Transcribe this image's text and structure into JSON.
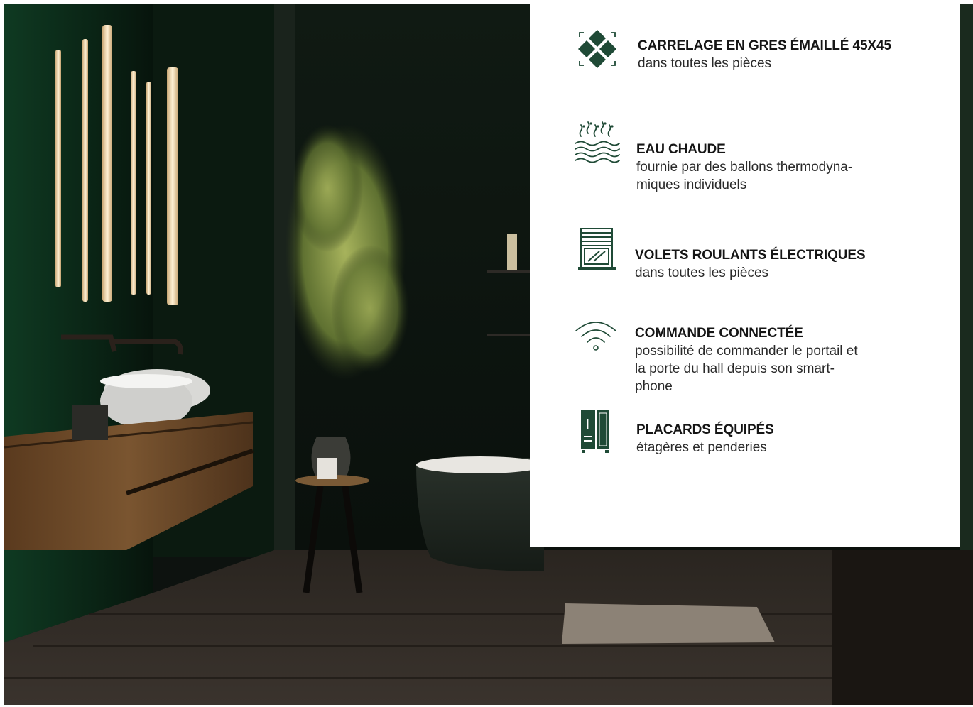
{
  "colors": {
    "accent": "#1f4a36",
    "panel_background": "#ffffff",
    "text": "#151515"
  },
  "photo": {
    "subject": "dark green bathroom interior"
  },
  "features": [
    {
      "icon": "tile-icon",
      "title": "CARRELAGE EN GRES ÉMAILLÉ 45X45",
      "desc": "dans toutes les pièces"
    },
    {
      "icon": "hot-water-icon",
      "title": "EAU CHAUDE",
      "desc": "fournie par des ballons thermodyna-\nmiques individuels"
    },
    {
      "icon": "roller-shutter-icon",
      "title": "VOLETS ROULANTS ÉLECTRIQUES",
      "desc": "dans toutes les pièces"
    },
    {
      "icon": "wifi-icon",
      "title": "COMMANDE CONNECTÉE",
      "desc": "possibilité de commander le portail et\nla porte du hall depuis son smart-\nphone"
    },
    {
      "icon": "wardrobe-icon",
      "title": "PLACARDS ÉQUIPÉS",
      "desc": "étagères et penderies"
    }
  ]
}
